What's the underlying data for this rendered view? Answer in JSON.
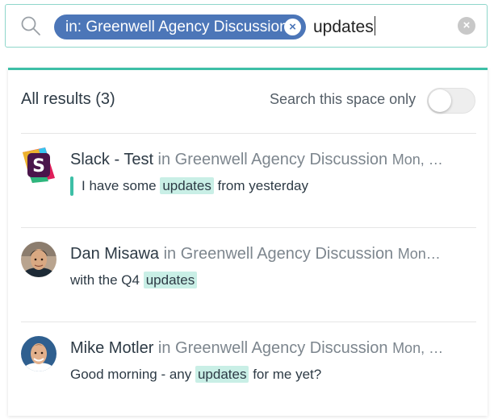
{
  "search": {
    "filter_chip": "in: Greenwell Agency Discussion",
    "chip_remove": "×",
    "query": "updates",
    "clear": "×"
  },
  "header": {
    "results_count": "All results (3)",
    "scope_label": "Search this space only",
    "scope_toggle_on": false
  },
  "colors": {
    "accent": "#3dbfa6",
    "chip": "#4c76b8",
    "highlight": "#c9efe6"
  },
  "results": [
    {
      "author": "Slack - Test",
      "in_space": " in Greenwell Agency Discussion",
      "time": "Mon, …",
      "avatar": "slack-logo-icon",
      "snippet_pre": "I have some ",
      "snippet_hl": "updates",
      "snippet_post": " from yesterday"
    },
    {
      "author": "Dan Misawa",
      "in_space": " in Greenwell Agency Discussion",
      "time": "Mon…",
      "avatar": "user-avatar",
      "snippet_pre": "with the Q4 ",
      "snippet_hl": "updates",
      "snippet_post": ""
    },
    {
      "author": "Mike Motler",
      "in_space": " in Greenwell Agency Discussion",
      "time": "Mon, …",
      "avatar": "user-avatar",
      "snippet_pre": "Good morning - any ",
      "snippet_hl": "updates",
      "snippet_post": " for me yet?"
    }
  ]
}
